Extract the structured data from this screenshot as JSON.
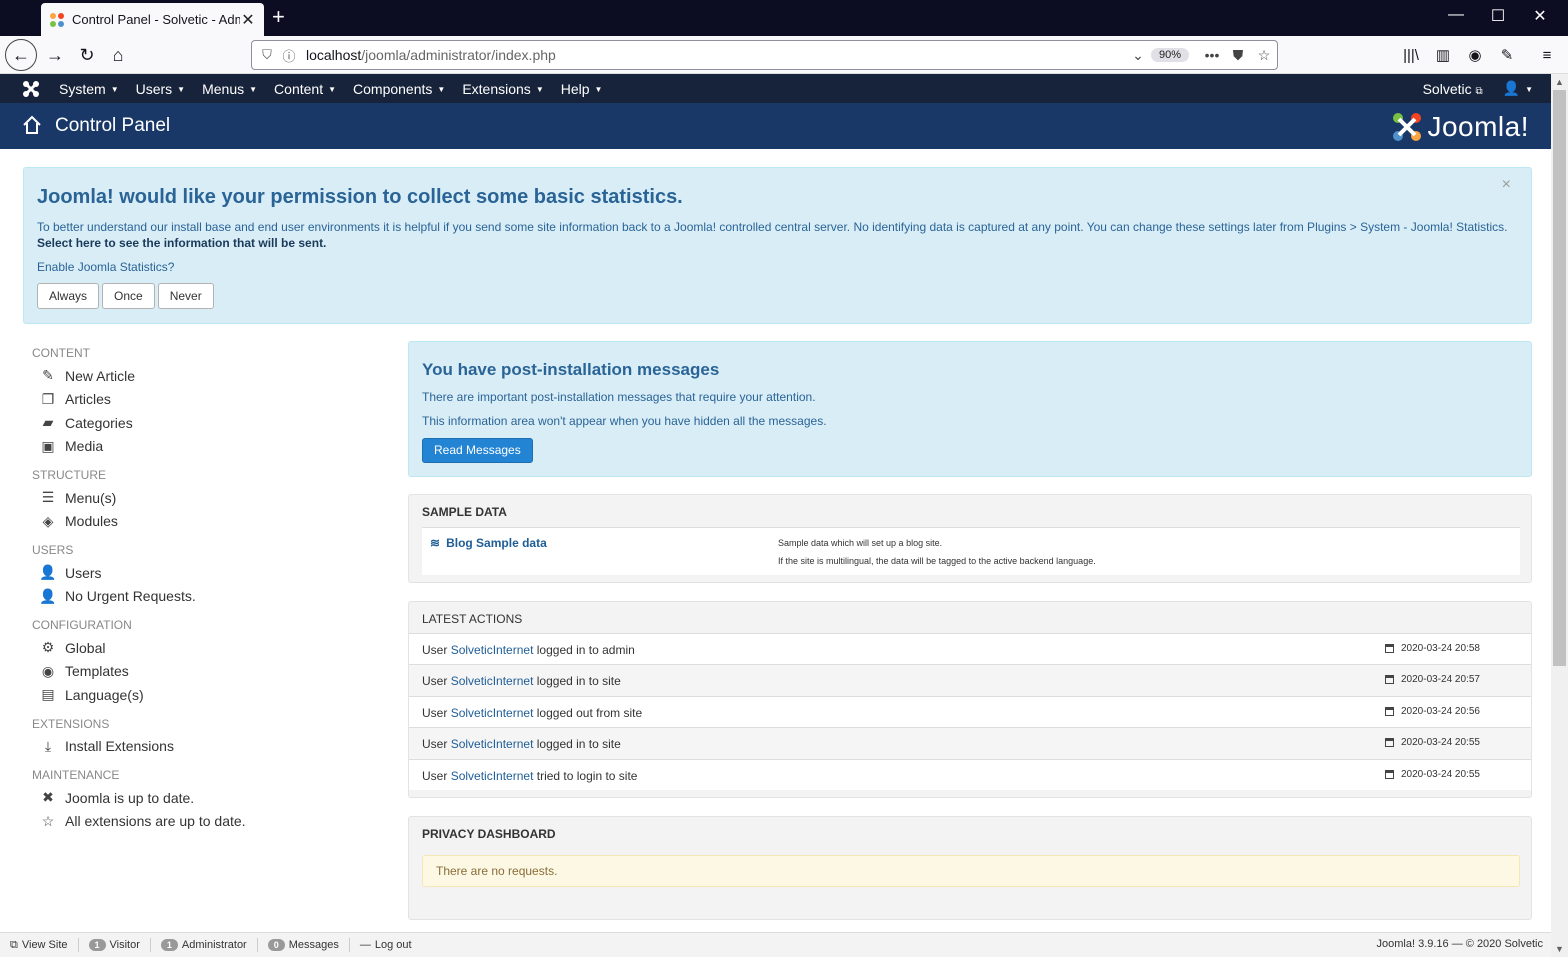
{
  "browser": {
    "tab_title": "Control Panel - Solvetic - Administration",
    "url_host": "localhost",
    "url_path": "/joomla/administrator/index.php",
    "zoom": "90%"
  },
  "topmenu": {
    "items": [
      "System",
      "Users",
      "Menus",
      "Content",
      "Components",
      "Extensions",
      "Help"
    ],
    "site_link": "Solvetic"
  },
  "title_bar": {
    "title": "Control Panel",
    "brand": "Joomla!"
  },
  "stats_alert": {
    "heading": "Joomla! would like your permission to collect some basic statistics.",
    "description": "To better understand our install base and end user environments it is helpful if you send some site information back to a Joomla! controlled central server. No identifying data is captured at any point. You can change these settings later from Plugins > System - Joomla! Statistics.",
    "select_link": "Select here to see the information that will be sent.",
    "enable_label": "Enable Joomla Statistics?",
    "buttons": [
      "Always",
      "Once",
      "Never"
    ],
    "close": "×"
  },
  "sidebar": {
    "content_head": "CONTENT",
    "content_items": [
      "New Article",
      "Articles",
      "Categories",
      "Media"
    ],
    "structure_head": "STRUCTURE",
    "structure_items": [
      "Menu(s)",
      "Modules"
    ],
    "users_head": "USERS",
    "users_items": [
      "Users",
      "No Urgent Requests."
    ],
    "config_head": "CONFIGURATION",
    "config_items": [
      "Global",
      "Templates",
      "Language(s)"
    ],
    "extensions_head": "EXTENSIONS",
    "extensions_items": [
      "Install Extensions"
    ],
    "maintenance_head": "MAINTENANCE",
    "maintenance_items": [
      "Joomla is up to date.",
      "All extensions are up to date."
    ]
  },
  "post_install": {
    "heading": "You have post-installation messages",
    "line1": "There are important post-installation messages that require your attention.",
    "line2": "This information area won't appear when you have hidden all the messages.",
    "button": "Read Messages"
  },
  "sample_data": {
    "heading": "SAMPLE DATA",
    "link": "Blog Sample data",
    "desc1": "Sample data which will set up a blog site.",
    "desc2": "If the site is multilingual, the data will be tagged to the active backend language."
  },
  "latest_actions": {
    "heading": "LATEST ACTIONS",
    "rows": [
      {
        "prefix": "User",
        "user": "SolveticInternet",
        "action": "logged in to admin",
        "date": "2020-03-24 20:58"
      },
      {
        "prefix": "User",
        "user": "SolveticInternet",
        "action": "logged in to site",
        "date": "2020-03-24 20:57"
      },
      {
        "prefix": "User",
        "user": "SolveticInternet",
        "action": "logged out from site",
        "date": "2020-03-24 20:56"
      },
      {
        "prefix": "User",
        "user": "SolveticInternet",
        "action": "logged in to site",
        "date": "2020-03-24 20:55"
      },
      {
        "prefix": "User",
        "user": "SolveticInternet",
        "action": "tried to login to site",
        "date": "2020-03-24 20:55"
      }
    ]
  },
  "privacy": {
    "heading": "PRIVACY DASHBOARD",
    "message": "There are no requests."
  },
  "statusbar": {
    "view_site": "View Site",
    "visitor_count": "1",
    "visitor_label": "Visitor",
    "admin_count": "1",
    "admin_label": "Administrator",
    "messages_count": "0",
    "messages_label": "Messages",
    "logout": "Log out",
    "copyright": "Joomla! 3.9.16 — © 2020 Solvetic"
  },
  "colors": {
    "nav_bg": "#17233a",
    "title_bg": "#1a3867",
    "alert_bg": "#d9edf7",
    "primary": "#2384d3"
  }
}
